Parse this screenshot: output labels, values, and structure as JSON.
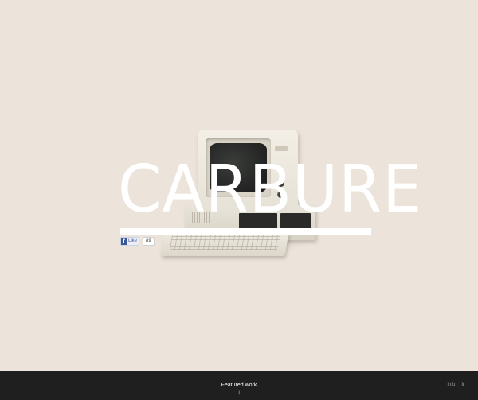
{
  "brand": {
    "logo_text": "CARBURE"
  },
  "social": {
    "like_label": "Like",
    "like_count": "89",
    "fb_icon": "facebook-f-icon"
  },
  "footer": {
    "featured_label": "Featured work",
    "arrow_icon": "arrow-down-icon",
    "arrow_glyph": "↓",
    "nav": {
      "info": "Info",
      "lang": "fr"
    }
  },
  "colors": {
    "background": "#ece4da",
    "footer": "#1f1f1f",
    "logo": "#ffffff",
    "facebook": "#3b5998"
  }
}
